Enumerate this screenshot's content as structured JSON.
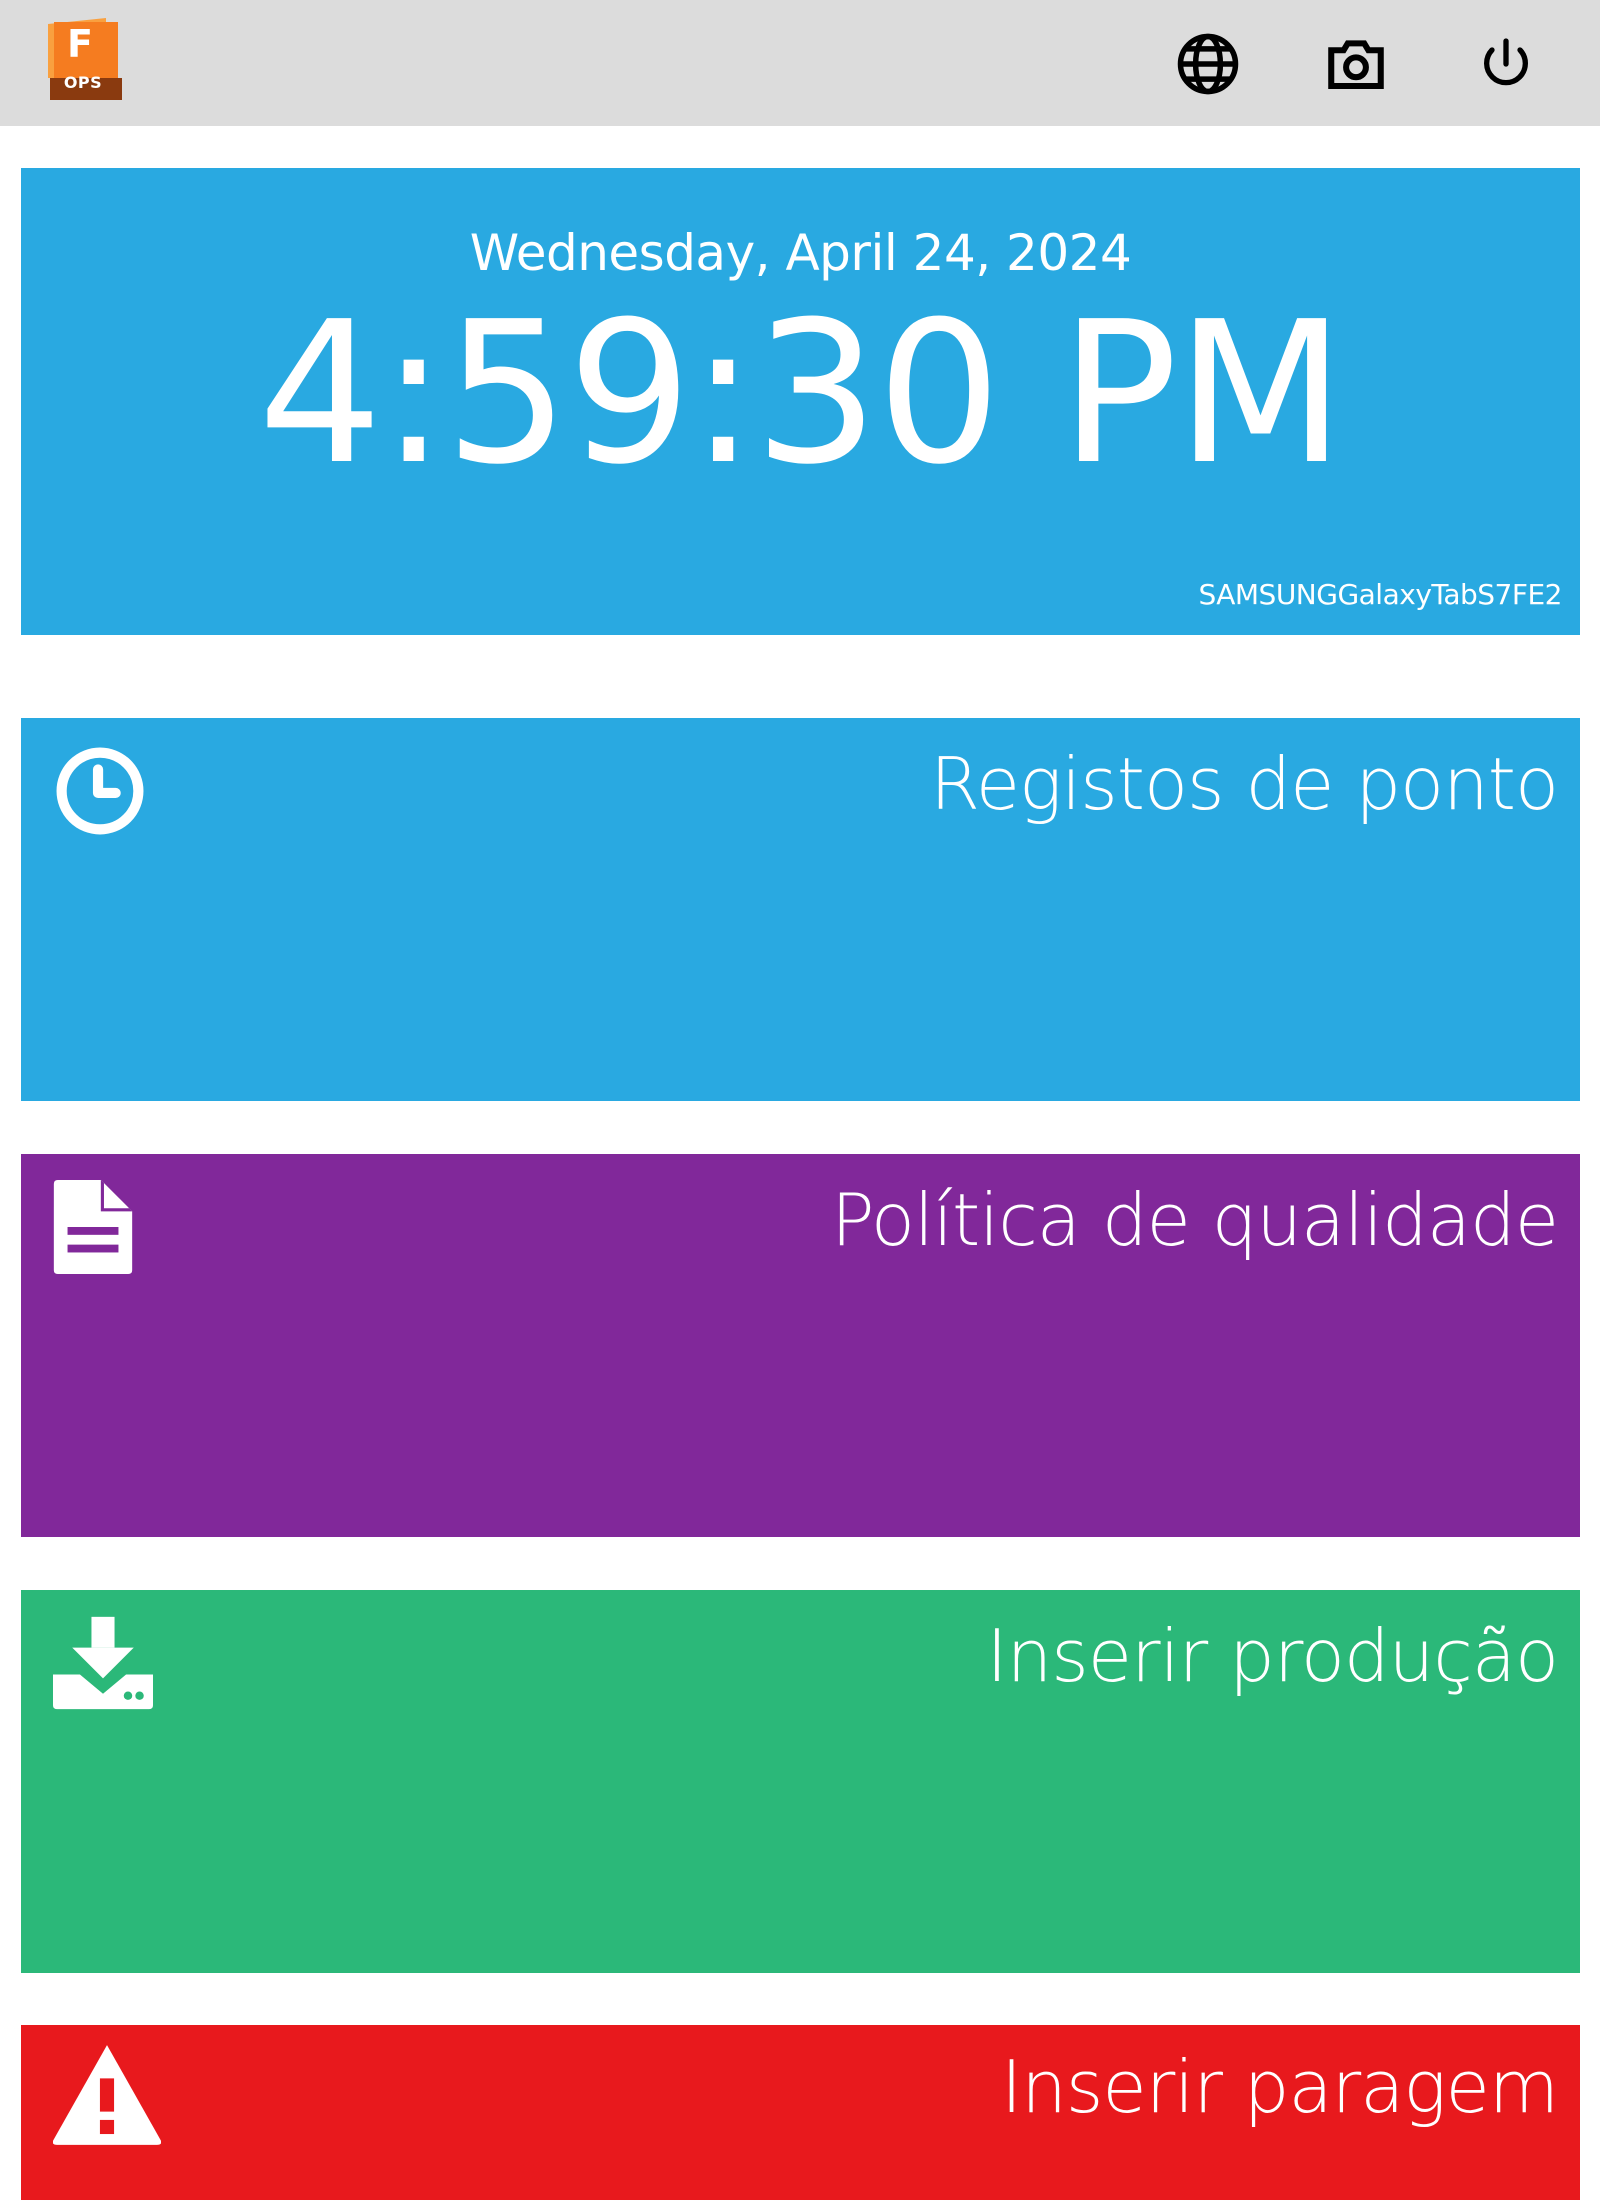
{
  "app": {
    "logo_letter": "F",
    "logo_text": "OPS"
  },
  "topbar": {
    "icons": [
      "globe-icon",
      "camera-icon",
      "power-icon"
    ]
  },
  "clock": {
    "date": "Wednesday, April 24, 2024",
    "time": "4:59:30 PM",
    "device": "SAMSUNGGalaxyTabS7FE2"
  },
  "tiles": [
    {
      "label": "Registos de ponto",
      "icon": "clock-icon",
      "color": "#29a9e1"
    },
    {
      "label": "Política de qualidade",
      "icon": "document-icon",
      "color": "#81289a"
    },
    {
      "label": "Inserir produção",
      "icon": "download-icon",
      "color": "#2bb879"
    },
    {
      "label": "Inserir paragem",
      "icon": "warning-icon",
      "color": "#e8191d"
    }
  ],
  "colors": {
    "topbar": "#dcdcdc",
    "logo_orange": "#f57c20",
    "logo_dark": "#8a3a0f"
  }
}
